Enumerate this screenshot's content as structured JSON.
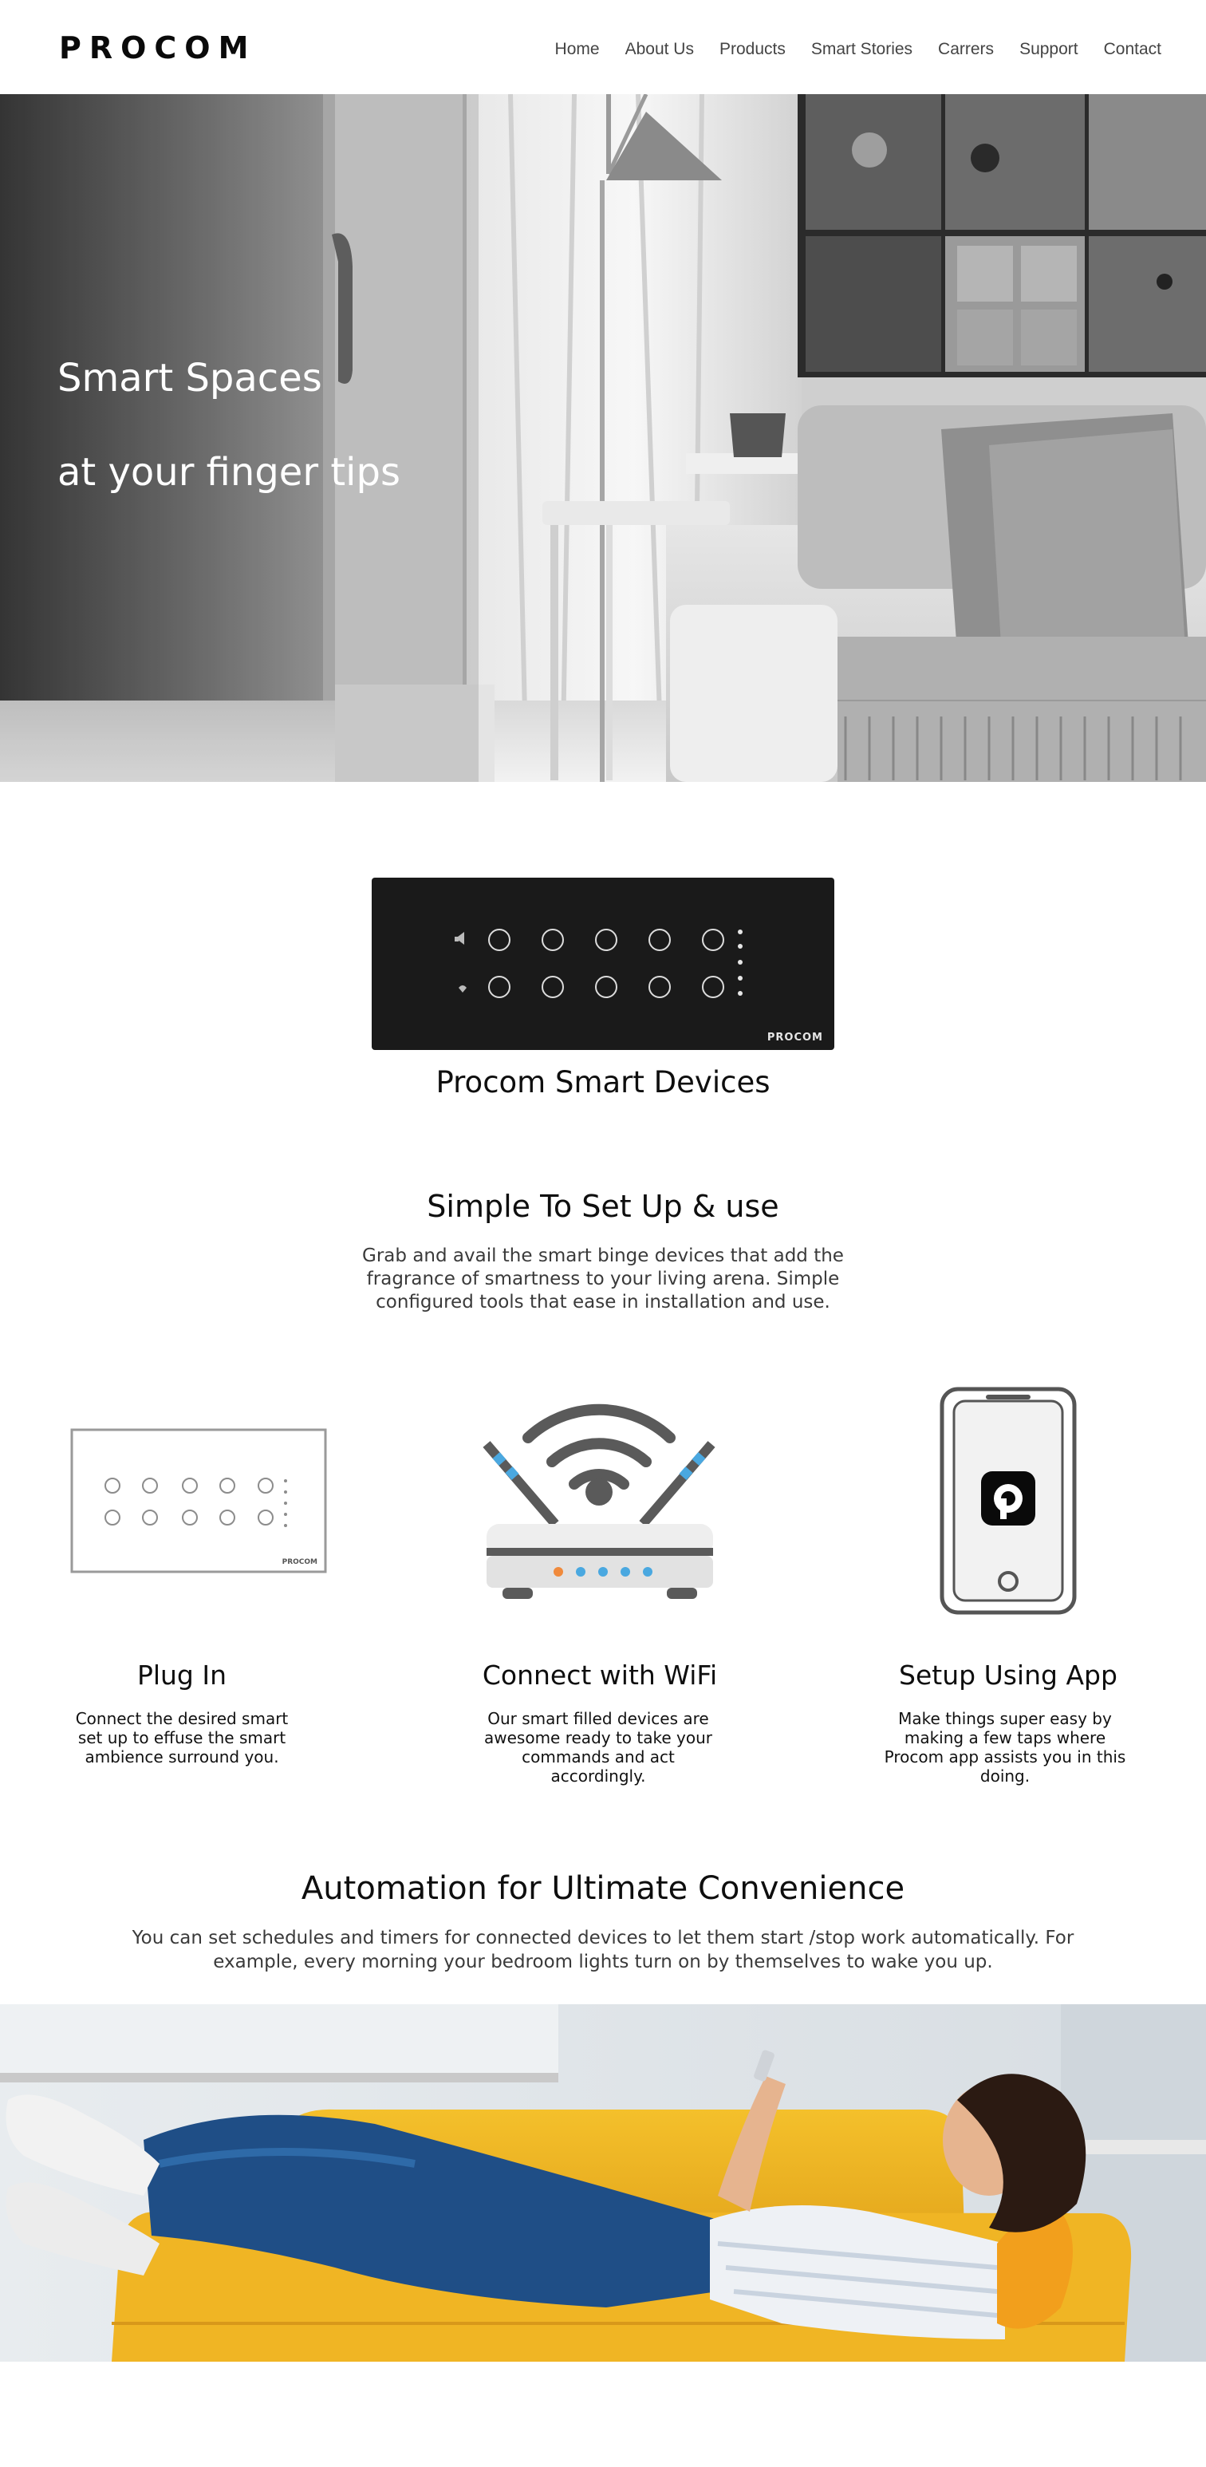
{
  "header": {
    "logo": "PROCOM",
    "nav": [
      "Home",
      "About Us",
      "Products",
      "Smart Stories",
      "Carrers",
      "Support",
      "Contact"
    ]
  },
  "hero": {
    "line1": "Smart Spaces",
    "line2": "at your finger tips"
  },
  "device": {
    "brand": "PROCOM",
    "caption": "Procom Smart Devices"
  },
  "setup": {
    "title": "Simple To Set Up & use",
    "text": "Grab and avail the smart binge devices that add the fragrance of smartness to your living arena. Simple configured tools that ease in installation and use."
  },
  "features": [
    {
      "title": "Plug In",
      "text": "Connect the desired smart set up to effuse the smart ambience surround you.",
      "icon": "switch-panel-icon"
    },
    {
      "title": "Connect with WiFi",
      "text": "Our smart filled devices are awesome ready to take your commands and act accordingly.",
      "icon": "wifi-router-icon"
    },
    {
      "title": "Setup Using App",
      "text": "Make things super easy by making a few taps where Procom app assists you in this doing.",
      "icon": "smartphone-app-icon"
    }
  ],
  "automation": {
    "title": "Automation for Ultimate Convenience",
    "text": "You can set schedules and timers for connected devices to let them start /stop work automatically. For example, every morning your bedroom lights turn on by themselves to wake you up."
  },
  "colors": {
    "panel": "#1a1a1a",
    "sofa": "#f2b423",
    "router_led_orange": "#f08a3c",
    "router_led_blue": "#4aa8e0"
  }
}
